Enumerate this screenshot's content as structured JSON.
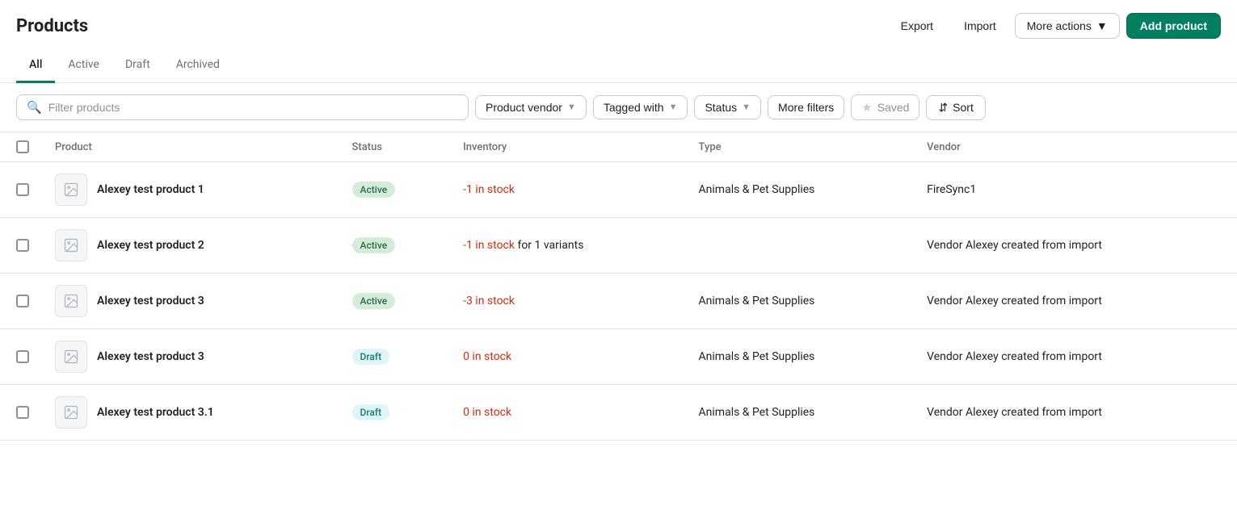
{
  "header": {
    "title": "Products",
    "actions": {
      "export_label": "Export",
      "import_label": "Import",
      "more_actions_label": "More actions",
      "add_product_label": "Add product"
    }
  },
  "tabs": [
    {
      "id": "all",
      "label": "All",
      "active": true
    },
    {
      "id": "active",
      "label": "Active",
      "active": false
    },
    {
      "id": "draft",
      "label": "Draft",
      "active": false
    },
    {
      "id": "archived",
      "label": "Archived",
      "active": false
    }
  ],
  "filters": {
    "search_placeholder": "Filter products",
    "product_vendor_label": "Product vendor",
    "tagged_with_label": "Tagged with",
    "status_label": "Status",
    "more_filters_label": "More filters",
    "saved_label": "Saved",
    "sort_label": "Sort"
  },
  "table": {
    "columns": [
      {
        "id": "checkbox",
        "label": ""
      },
      {
        "id": "product",
        "label": "Product"
      },
      {
        "id": "status",
        "label": "Status"
      },
      {
        "id": "inventory",
        "label": "Inventory"
      },
      {
        "id": "type",
        "label": "Type"
      },
      {
        "id": "vendor",
        "label": "Vendor"
      }
    ],
    "rows": [
      {
        "name": "Alexey test product 1",
        "status": "Active",
        "status_type": "active",
        "inventory_prefix": "-1 in stock",
        "inventory_suffix": "",
        "type": "Animals & Pet Supplies",
        "vendor": "FireSync1"
      },
      {
        "name": "Alexey test product 2",
        "status": "Active",
        "status_type": "active",
        "inventory_prefix": "-1 in stock",
        "inventory_suffix": " for 1 variants",
        "type": "",
        "vendor": "Vendor Alexey created from import"
      },
      {
        "name": "Alexey test product 3",
        "status": "Active",
        "status_type": "active",
        "inventory_prefix": "-3 in stock",
        "inventory_suffix": "",
        "type": "Animals & Pet Supplies",
        "vendor": "Vendor Alexey created from import"
      },
      {
        "name": "Alexey test product 3",
        "status": "Draft",
        "status_type": "draft",
        "inventory_prefix": "0 in stock",
        "inventory_suffix": "",
        "type": "Animals & Pet Supplies",
        "vendor": "Vendor Alexey created from import"
      },
      {
        "name": "Alexey test product 3.1",
        "status": "Draft",
        "status_type": "draft",
        "inventory_prefix": "0 in stock",
        "inventory_suffix": "",
        "type": "Animals & Pet Supplies",
        "vendor": "Vendor Alexey created from import"
      }
    ]
  }
}
